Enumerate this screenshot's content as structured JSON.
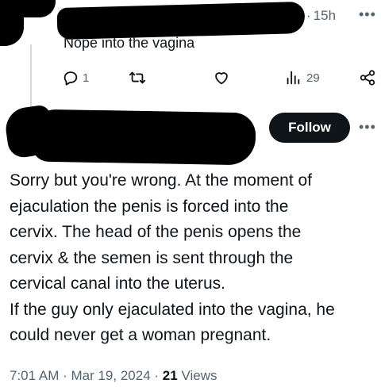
{
  "reply": {
    "time": "15h",
    "text": "Nope into the vagina",
    "reply_count": "1",
    "views_count": "29"
  },
  "author": {
    "follow_label": "Follow"
  },
  "tweet": {
    "lines": [
      "Sorry but you're wrong. At the moment of",
      "ejaculation the penis is forced into the",
      "cervix. The head of the penis opens the",
      "cervix & the semen is sent through the",
      "cervical canal into the uterus.",
      "If the guy only ejaculated into the vagina, he",
      "could never get a woman pregnant."
    ],
    "timestamp": "7:01 AM · Mar 19, 2024",
    "views_count": "21",
    "views_label": "Views"
  },
  "icons": {
    "reply": "reply-icon",
    "retweet": "retweet-icon",
    "like": "heart-icon",
    "views": "views-icon",
    "share": "share-icon",
    "more": "more-icon"
  },
  "colors": {
    "text": "#0f1419",
    "muted": "#536471",
    "follow_bg": "#0f1419",
    "thread_line": "#cfd9de"
  }
}
